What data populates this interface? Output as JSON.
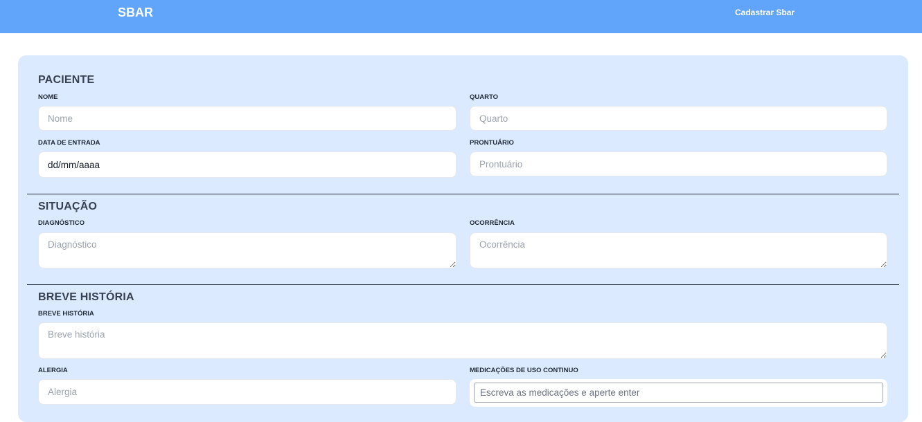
{
  "header": {
    "brand": "SBAR",
    "nav_link": "Cadastrar Sbar"
  },
  "form": {
    "paciente": {
      "title": "PACIENTE",
      "nome": {
        "label": "NOME",
        "placeholder": "Nome"
      },
      "quarto": {
        "label": "QUARTO",
        "placeholder": "Quarto"
      },
      "data_entrada": {
        "label": "DATA DE ENTRADA",
        "value": "dd/mm/aaaa"
      },
      "prontuario": {
        "label": "PRONTUÁRIO",
        "placeholder": "Prontuário"
      }
    },
    "situacao": {
      "title": "SITUAÇÃO",
      "diagnostico": {
        "label": "DIAGNÓSTICO",
        "placeholder": "Diagnóstico"
      },
      "ocorrencia": {
        "label": "OCORRÊNCIA",
        "placeholder": "Ocorrência"
      }
    },
    "breve_historia": {
      "title": "BREVE HISTÓRIA",
      "historia": {
        "label": "BREVE HISTÓRIA",
        "placeholder": "Breve história"
      },
      "alergia": {
        "label": "ALERGIA",
        "placeholder": "Alergia"
      },
      "medicacoes": {
        "label": "MEDICAÇÕES DE USO CONTINUO",
        "placeholder": "Escreva as medicações e aperte enter"
      }
    }
  },
  "colors": {
    "header_bg": "#60a5fa",
    "card_bg": "#dbeafe",
    "divider": "#1f2937"
  }
}
